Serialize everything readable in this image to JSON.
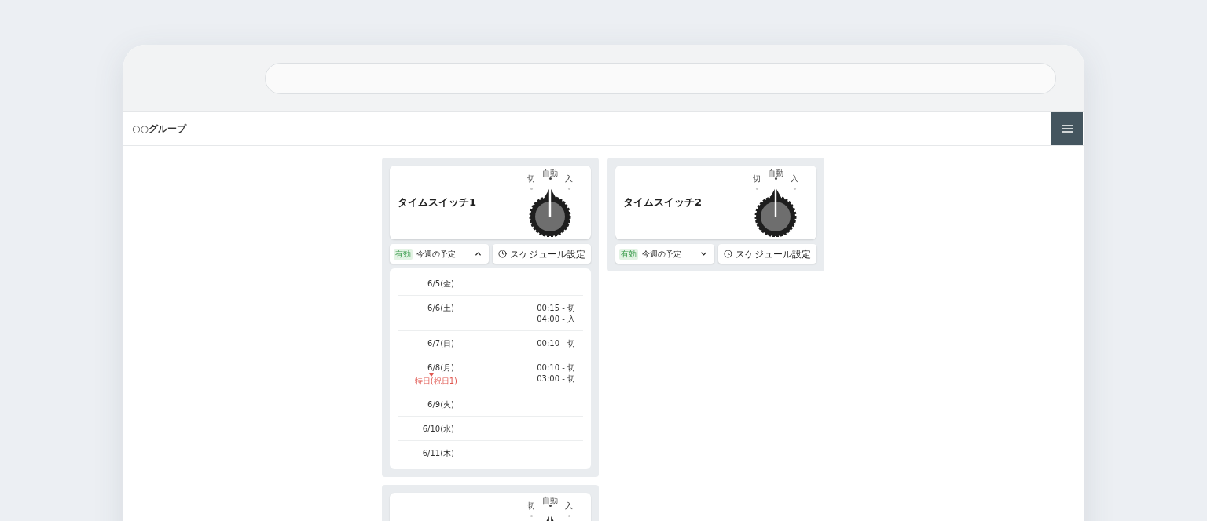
{
  "header": {
    "title": "○○グループ"
  },
  "switches": [
    {
      "name": "タイムスイッチ1",
      "dial": [
        {
          "label": "切",
          "selected": false
        },
        {
          "label": "自動",
          "selected": true
        },
        {
          "label": "入",
          "selected": false
        }
      ],
      "status_badge": "有効",
      "schedule_toggle": {
        "label": "今週の予定",
        "expanded": true
      },
      "settings_button": "スケジュール設定",
      "schedule": [
        {
          "date": "6/5(金)"
        },
        {
          "date": "6/6(土)",
          "entries": [
            "00:15 - 切",
            "04:00 - 入"
          ]
        },
        {
          "date": "6/7(日)",
          "entries": [
            "00:10 - 切"
          ]
        },
        {
          "date": "6/8(月)",
          "note": "特日(祝日1)",
          "entries": [
            "00:10 - 切",
            "03:00 - 切"
          ]
        },
        {
          "date": "6/9(火)"
        },
        {
          "date": "6/10(水)"
        },
        {
          "date": "6/11(木)"
        }
      ]
    },
    {
      "name": "タイムスイッチ2",
      "dial": [
        {
          "label": "切",
          "selected": false
        },
        {
          "label": "自動",
          "selected": true
        },
        {
          "label": "入",
          "selected": false
        }
      ],
      "status_badge": "有効",
      "schedule_toggle": {
        "label": "今週の予定",
        "expanded": false
      },
      "settings_button": "スケジュール設定"
    },
    {
      "dial": [
        {
          "label": "切",
          "selected": false
        },
        {
          "label": "自動",
          "selected": true
        },
        {
          "label": "入",
          "selected": false
        }
      ]
    }
  ]
}
